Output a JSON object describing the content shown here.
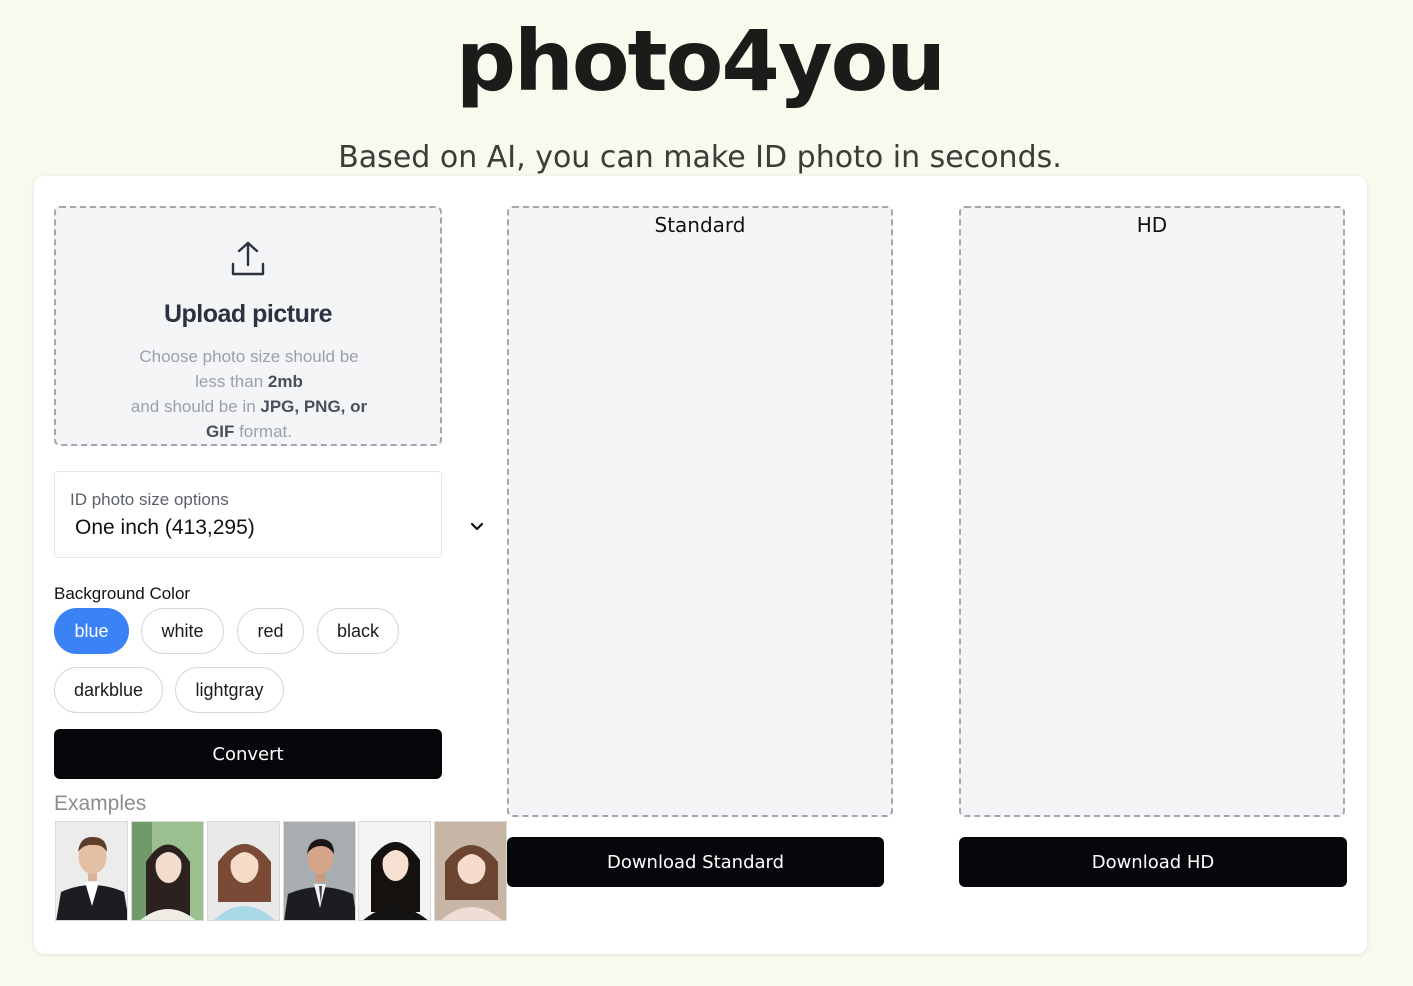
{
  "header": {
    "brand": "photo4you",
    "tagline": "Based on AI, you can make ID photo in seconds."
  },
  "upload": {
    "icon": "upload-icon",
    "title": "Upload picture",
    "hint_line1": "Choose photo size should be",
    "hint_line2_pre": "less than ",
    "hint_size": "2mb",
    "hint_line3_pre": "and should be in ",
    "hint_formats": "JPG, PNG, or",
    "hint_line4_bold": "GIF",
    "hint_line4_post": " format."
  },
  "size_select": {
    "label": "ID photo size options",
    "value": "One inch (413,295)",
    "icon": "chevron-down-icon"
  },
  "background": {
    "label": "Background Color",
    "options": [
      "blue",
      "white",
      "red",
      "black",
      "darkblue",
      "lightgray"
    ],
    "selected": "blue",
    "accent": "#3b82f6"
  },
  "actions": {
    "convert": "Convert",
    "download_standard": "Download Standard",
    "download_hd": "Download HD"
  },
  "examples": {
    "label": "Examples",
    "count": 6
  },
  "panels": {
    "standard_title": "Standard",
    "hd_title": "HD"
  }
}
